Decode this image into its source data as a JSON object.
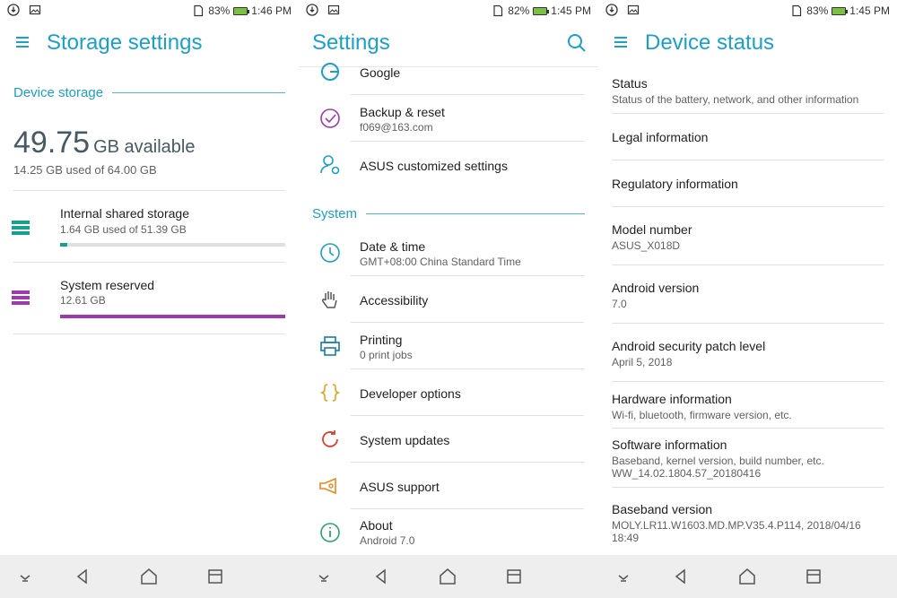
{
  "colors": {
    "accent": "#1ba0c8",
    "teal": "#15a08f",
    "purple": "#9c3aae",
    "navbar_bg": "#eeeeee"
  },
  "status_bars": [
    {
      "battery": "83%",
      "time": "1:46 PM"
    },
    {
      "battery": "82%",
      "time": "1:45 PM"
    },
    {
      "battery": "83%",
      "time": "1:45 PM"
    }
  ],
  "storage": {
    "title": "Storage settings",
    "section": "Device storage",
    "available_number": "49.75",
    "available_unit": "GB available",
    "used_summary": "14.25 GB used of 64.00 GB",
    "items": [
      {
        "icon": "storage-stack-icon",
        "title": "Internal shared storage",
        "subtitle": "1.64 GB used of 51.39 GB",
        "fraction": 0.032,
        "color": "#15a08f"
      },
      {
        "icon": "storage-stack-icon",
        "title": "System reserved",
        "subtitle": "12.61 GB",
        "fraction": 1.0,
        "color": "#9c3aae"
      }
    ]
  },
  "settings": {
    "title": "Settings",
    "rows_top": [
      {
        "icon": "google-icon",
        "title": "Google",
        "subtitle": ""
      },
      {
        "icon": "backup-icon",
        "title": "Backup & reset",
        "subtitle": "f069@163.com"
      },
      {
        "icon": "asus-settings-icon",
        "title": "ASUS customized settings",
        "subtitle": ""
      }
    ],
    "section": "System",
    "rows_system": [
      {
        "icon": "clock-icon",
        "title": "Date & time",
        "subtitle": "GMT+08:00 China Standard Time"
      },
      {
        "icon": "hand-icon",
        "title": "Accessibility",
        "subtitle": ""
      },
      {
        "icon": "printer-icon",
        "title": "Printing",
        "subtitle": "0 print jobs"
      },
      {
        "icon": "braces-icon",
        "title": "Developer options",
        "subtitle": ""
      },
      {
        "icon": "refresh-icon",
        "title": "System updates",
        "subtitle": ""
      },
      {
        "icon": "megaphone-icon",
        "title": "ASUS support",
        "subtitle": ""
      },
      {
        "icon": "info-icon",
        "title": "About",
        "subtitle": "Android 7.0"
      }
    ]
  },
  "device": {
    "title": "Device status",
    "rows": [
      {
        "title": "Status",
        "subtitle": "Status of the battery, network, and other information"
      },
      {
        "title": "Legal information",
        "subtitle": ""
      },
      {
        "title": "Regulatory information",
        "subtitle": ""
      },
      {
        "title": "Model number",
        "subtitle": "ASUS_X018D"
      },
      {
        "title": "Android version",
        "subtitle": "7.0"
      },
      {
        "title": "Android security patch level",
        "subtitle": "April 5, 2018"
      },
      {
        "title": "Hardware information",
        "subtitle": "Wi-fi, bluetooth, firmware version, etc."
      },
      {
        "title": "Software information",
        "subtitle": "Baseband, kernel version, build number, etc.",
        "subtitle2": "WW_14.02.1804.57_20180416"
      },
      {
        "title": "Baseband version",
        "subtitle": "MOLY.LR11.W1603.MD.MP.V35.4.P114, 2018/04/16",
        "subtitle2": "18:49"
      }
    ]
  },
  "navbar_icons": [
    "collapse-icon",
    "back-icon",
    "home-icon",
    "recents-icon"
  ]
}
